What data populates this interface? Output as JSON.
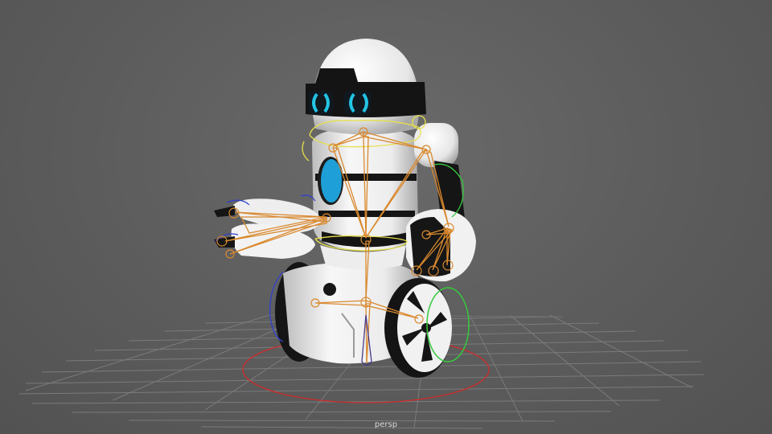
{
  "viewport": {
    "camera_name": "persp",
    "background_color": "#5f5f5f"
  },
  "scene": {
    "subject": "robot",
    "grid_color": "#7a7a7a",
    "body_color": "#f2f2f2",
    "trim_color": "#111111",
    "eye_color": "#27c9e6",
    "chest_light_color": "#1e9fd8",
    "joint_color": "#d9892e",
    "curve_yellow": "#e6e04a",
    "curve_green": "#36c93e",
    "curve_blue": "#3040d0",
    "curve_red": "#d02a2a",
    "controls": [
      "head-control",
      "waist-control",
      "root-control",
      "right-wheel-control",
      "left-wheel-control",
      "right-arm-control"
    ]
  }
}
